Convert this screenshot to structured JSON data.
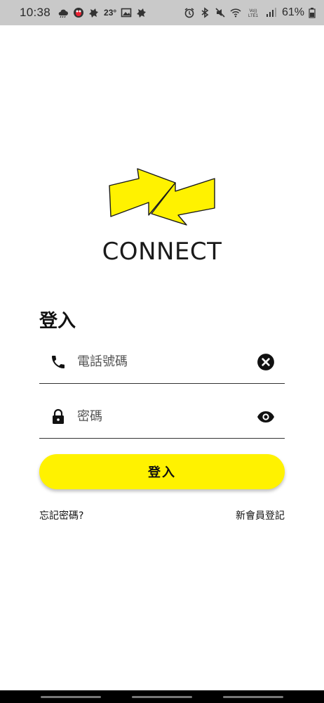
{
  "status_bar": {
    "time": "10:38",
    "temperature": "23°",
    "battery_percent": "61%",
    "left_icons": [
      "cloud-icon",
      "weather-sticker-icon",
      "notification-icon",
      "gallery-icon",
      "notification-icon"
    ],
    "right_icons": [
      "alarm-icon",
      "bluetooth-icon",
      "mute-icon",
      "wifi-icon",
      "volte-icon",
      "signal-icon",
      "battery-icon"
    ],
    "volte_text": "Vo)) LTE1"
  },
  "logo": {
    "text": "CONNECT",
    "arrow_color": "#fff200"
  },
  "login": {
    "heading": "登入",
    "phone_placeholder": "電話號碼",
    "phone_value": "",
    "password_placeholder": "密碼",
    "password_value": "",
    "button_label": "登入",
    "forgot_link": "忘記密碼?",
    "register_link": "新會員登記"
  },
  "colors": {
    "accent": "#fff200",
    "status_bar_bg": "#c9c9c9",
    "text": "#1b1b1b"
  }
}
